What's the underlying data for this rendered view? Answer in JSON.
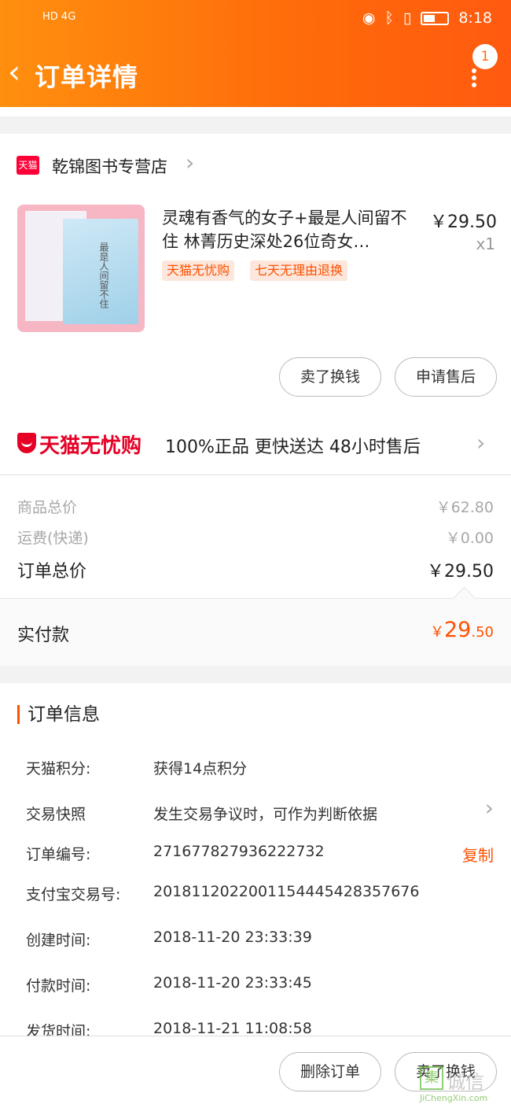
{
  "status_bar": {
    "left": "HD 4G",
    "time": "8:18"
  },
  "header": {
    "title": "订单详情",
    "badge_count": "1"
  },
  "shop": {
    "name": "乾锦图书专营店",
    "logo_text": "天猫"
  },
  "item": {
    "title": "灵魂有香气的女子+最是人间留不住 林菁历史深处26位奇女…",
    "price": "￥29.50",
    "qty": "x1",
    "tags": [
      "天猫无忧购",
      "七天无理由退换"
    ],
    "cover_text": "最是人间留不住"
  },
  "item_actions": {
    "sell": "卖了换钱",
    "aftersale": "申请售后"
  },
  "wuyou": {
    "brand": "天猫无忧购",
    "text": "100%正品  更快送达  48小时售后"
  },
  "summary": {
    "goods_label": "商品总价",
    "goods_value": "￥62.80",
    "ship_label": "运费(快递)",
    "ship_value": "￥0.00",
    "total_label": "订单总价",
    "total_value": "￥29.50"
  },
  "paid": {
    "label": "实付款",
    "currency": "￥",
    "int": "29",
    "dec": ".50"
  },
  "order_info": {
    "title": "订单信息",
    "rows": [
      {
        "k": "天猫积分:",
        "v": "获得14点积分"
      },
      {
        "k": "交易快照",
        "v": "发生交易争议时，可作为判断依据"
      },
      {
        "k": "订单编号:",
        "v": "271677827936222732"
      },
      {
        "k": "支付宝交易号:",
        "v": "2018112022001154445428357676"
      },
      {
        "k": "创建时间:",
        "v": "2018-11-20 23:33:39"
      },
      {
        "k": "付款时间:",
        "v": "2018-11-20 23:33:45"
      },
      {
        "k": "发货时间:",
        "v": "2018-11-21 11:08:58"
      }
    ],
    "copy_label": "复制"
  },
  "bottom": {
    "delete": "删除订单",
    "sell": "卖了换钱"
  },
  "watermark": {
    "text": "JiChengXin.com",
    "brand": "诚信"
  },
  "colors": {
    "accent": "#ff5000",
    "header_start": "#ff8f0f",
    "header_end": "#ff5a10",
    "tmall_red": "#e60026"
  }
}
